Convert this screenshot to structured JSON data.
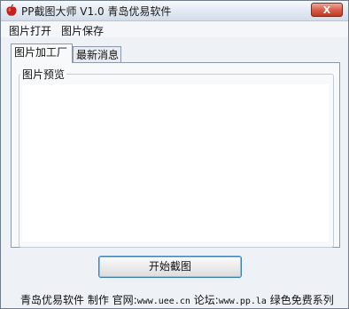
{
  "window": {
    "title": "PP截图大师 V1.0 青岛优易软件",
    "close_label": "X"
  },
  "menu": {
    "items": [
      {
        "label": "图片打开"
      },
      {
        "label": "图片保存"
      }
    ]
  },
  "tabs": [
    {
      "label": "图片加工厂",
      "active": true
    },
    {
      "label": "最新消息",
      "active": false
    }
  ],
  "group": {
    "title": "图片预览"
  },
  "actions": {
    "start_label": "开始截图"
  },
  "status": {
    "prefix": "青岛优易软件 制作 官网:",
    "site": "www.uee.cn",
    "forum_label": " 论坛:",
    "forum_url": "www.pp.la",
    "suffix": " 绿色免费系列"
  },
  "colors": {
    "window_bg": "#eef1f6",
    "close_button": "#c2381f",
    "button_border": "#3c7fb1"
  }
}
